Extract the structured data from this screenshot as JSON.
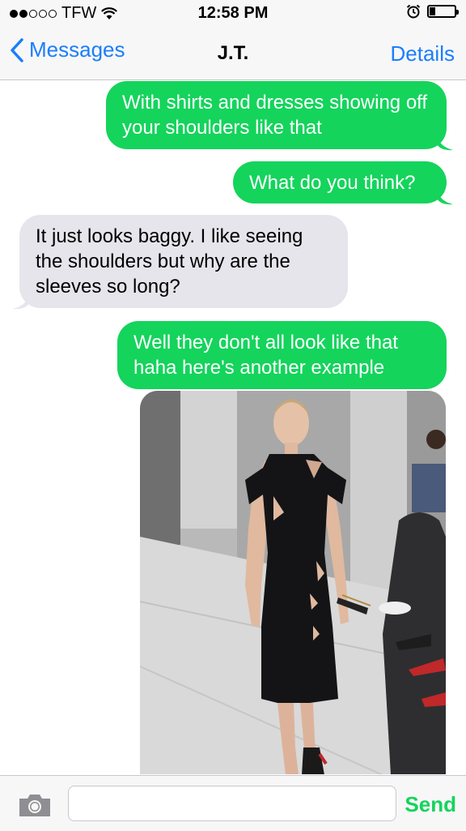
{
  "status": {
    "carrier": "TFW",
    "time": "12:58 PM"
  },
  "nav": {
    "back_label": "Messages",
    "title": "J.T.",
    "details_label": "Details"
  },
  "messages": [
    {
      "from": "me",
      "text": "With shirts and dresses showing off your shoulders like that"
    },
    {
      "from": "me",
      "text": "What do you think?"
    },
    {
      "from": "them",
      "text": "It just looks baggy. I like seeing the shoulders but why are the sleeves so long?"
    },
    {
      "from": "me",
      "text": "Well they don't all look like that haha here's another example"
    }
  ],
  "input": {
    "placeholder": "",
    "send_label": "Send"
  },
  "colors": {
    "sent_bubble": "#14d45c",
    "received_bubble": "#e6e5eb",
    "accent": "#1b7efb"
  }
}
